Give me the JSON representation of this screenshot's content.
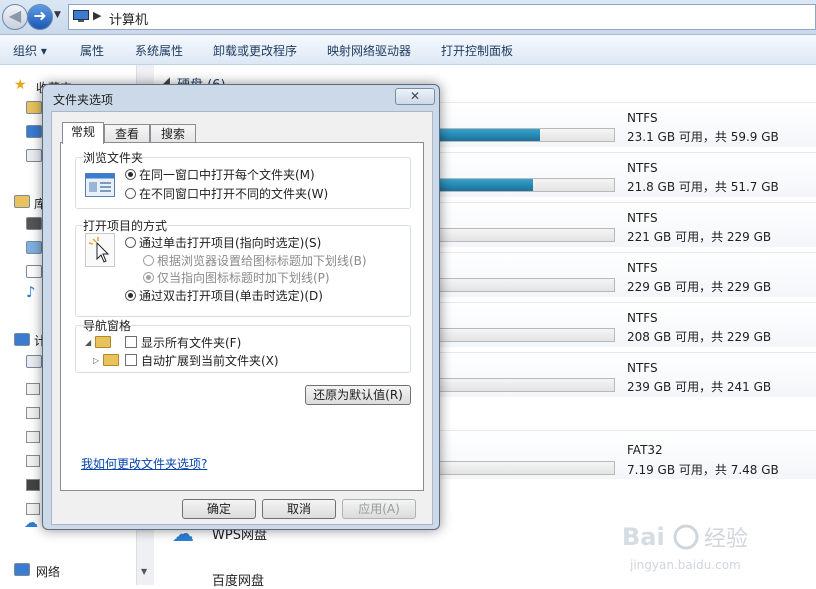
{
  "address_bar": {
    "path": "计算机"
  },
  "toolbar": {
    "organize": "组织",
    "properties": "属性",
    "system_properties": "系统属性",
    "uninstall": "卸载或更改程序",
    "map_drive": "映射网络驱动器",
    "control_panel": "打开控制面板"
  },
  "nav_pane": {
    "favorites": "收藏夹",
    "libraries": "库",
    "computer": "计",
    "network": "网络"
  },
  "content": {
    "group_header": "硬盘 (6)",
    "drives": [
      {
        "fs": "NTFS",
        "capacity": "23.1 GB 可用，共 59.9 GB",
        "used_fraction": 0.614
      },
      {
        "fs": "NTFS",
        "capacity": "21.8 GB 可用，共 51.7 GB",
        "used_fraction": 0.578
      },
      {
        "fs": "NTFS",
        "capacity": "221 GB 可用，共 229 GB",
        "used_fraction": 0.035
      },
      {
        "fs": "NTFS",
        "capacity": "229 GB 可用，共 229 GB",
        "used_fraction": 0.0
      },
      {
        "fs": "NTFS",
        "capacity": "208 GB 可用，共 229 GB",
        "used_fraction": 0.092
      },
      {
        "fs": "NTFS",
        "capacity": "239 GB 可用，共 241 GB",
        "used_fraction": 0.008
      }
    ],
    "removable": {
      "fs": "FAT32",
      "capacity": "7.19 GB 可用，共 7.48 GB",
      "used_fraction": 0.039
    },
    "wps_cloud": "WPS网盘",
    "baidu_cloud": "百度网盘"
  },
  "dialog": {
    "title": "文件夹选项",
    "close": "✕",
    "tabs": [
      "常规",
      "查看",
      "搜索"
    ],
    "browse_group": {
      "title": "浏览文件夹",
      "opt_same": "在同一窗口中打开每个文件夹(M)",
      "opt_new": "在不同窗口中打开不同的文件夹(W)",
      "selected": "same"
    },
    "click_group": {
      "title": "打开项目的方式",
      "opt_single": "通过单击打开项目(指向时选定)(S)",
      "opt_browser": "根据浏览器设置给图标标题加下划线(B)",
      "opt_hover": "仅当指向图标标题时加下划线(P)",
      "opt_double": "通过双击打开项目(单击时选定)(D)",
      "selected": "double"
    },
    "nav_group": {
      "title": "导航窗格",
      "show_all": "显示所有文件夹(F)",
      "auto_expand": "自动扩展到当前文件夹(X)",
      "show_all_checked": false,
      "auto_expand_checked": false
    },
    "restore_defaults": "还原为默认值(R)",
    "help_link": "我如何更改文件夹选项?",
    "ok": "确定",
    "cancel": "取消",
    "apply": "应用(A)"
  },
  "watermark": {
    "logo": "Bai 经验",
    "url": "jingyan.baidu.com"
  },
  "colors": {
    "accent": "#1d6f9a",
    "link": "#0645ad",
    "dialog_frame": "#cbd9e8"
  }
}
